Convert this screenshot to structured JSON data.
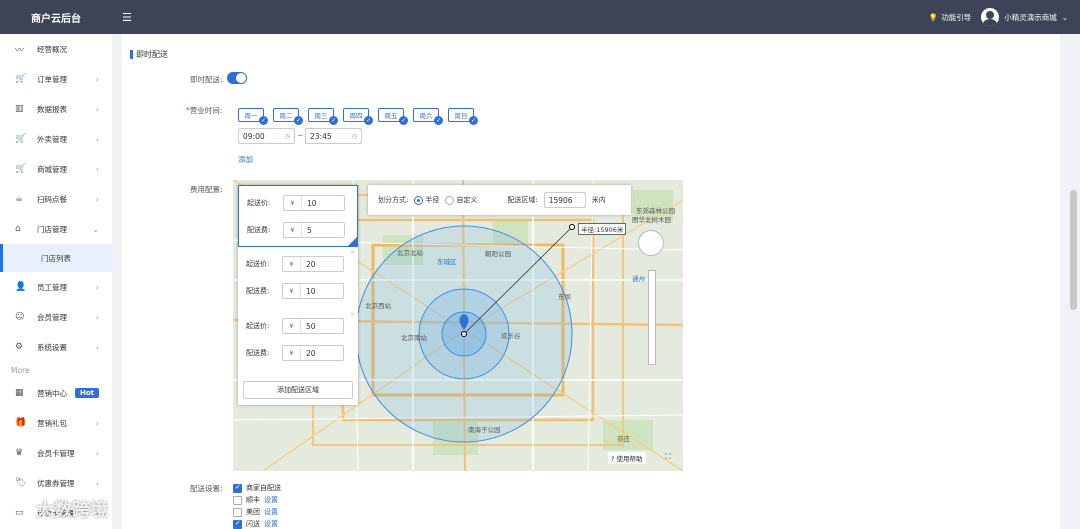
{
  "app": {
    "title": "商户云后台",
    "guide_label": "功能引导",
    "user_name": "小精灵演示商城"
  },
  "sidebar": {
    "items": [
      {
        "label": "经营概况",
        "icon": "trend-icon"
      },
      {
        "label": "订单管理",
        "icon": "cart-icon"
      },
      {
        "label": "数据报表",
        "icon": "bar-chart-icon"
      },
      {
        "label": "外卖管理",
        "icon": "cart-icon"
      },
      {
        "label": "商城管理",
        "icon": "cart-icon"
      },
      {
        "label": "扫码点餐",
        "icon": "cup-icon"
      },
      {
        "label": "门店管理",
        "icon": "home-icon"
      }
    ],
    "sub_item": "门店列表",
    "items2": [
      {
        "label": "员工管理",
        "icon": "user-icon"
      },
      {
        "label": "会员管理",
        "icon": "smile-icon"
      },
      {
        "label": "系统设置",
        "icon": "gear-icon"
      }
    ],
    "more_label": "More",
    "items3": [
      {
        "label": "营销中心",
        "icon": "grid-icon",
        "badge": "Hot"
      },
      {
        "label": "营销礼包",
        "icon": "gift-icon"
      },
      {
        "label": "会员卡管理",
        "icon": "crown-icon"
      },
      {
        "label": "优惠券管理",
        "icon": "tag-icon"
      },
      {
        "label": "计次卡管理",
        "icon": "card-icon"
      }
    ]
  },
  "main": {
    "section_title": "即时配送",
    "instant_label": "即时配送:",
    "instant_on": true,
    "hours_label": "营业时间:",
    "required_mark": "*",
    "days": [
      "周一",
      "周二",
      "周三",
      "周四",
      "周五",
      "周六",
      "周日"
    ],
    "start_time": "09:00",
    "end_time": "23:45",
    "tilde": "~",
    "add_label": "添加",
    "fee_label": "费用配置:",
    "zones": [
      {
        "min_label": "起送价:",
        "min": "10",
        "fee_label": "配送费:",
        "fee": "5"
      },
      {
        "min_label": "起送价:",
        "min": "20",
        "fee_label": "配送费:",
        "fee": "10"
      },
      {
        "min_label": "起送价:",
        "min": "50",
        "fee_label": "配送费:",
        "fee": "20"
      }
    ],
    "currency": "¥",
    "add_zone": "添加配送区域",
    "divide_label": "划分方式:",
    "radius_option": "半径",
    "custom_option": "自定义",
    "area_label": "配送区域:",
    "area_value": "15906",
    "area_unit": "米内",
    "radius_tag": "半径:15906米",
    "help_label": "使用帮助",
    "map_labels": [
      "北京北站",
      "东城区",
      "朝阳公园",
      "北京西站",
      "北京南站",
      "欢乐谷",
      "东坝",
      "通州",
      "南海子公园",
      "东郊森林公园",
      "图华北树木园",
      "亦庄"
    ]
  },
  "delivery": {
    "label": "配送设置:",
    "options": [
      {
        "name": "商家自配送",
        "checked": true,
        "setting": ""
      },
      {
        "name": "顺丰",
        "checked": false,
        "setting": "设置"
      },
      {
        "name": "美团",
        "checked": false,
        "setting": "设置"
      },
      {
        "name": "闪送",
        "checked": true,
        "setting": "设置"
      }
    ]
  },
  "watermark": "大数跨境",
  "colors": {
    "primary": "#2f6fd6",
    "topbar": "#3d4458"
  }
}
